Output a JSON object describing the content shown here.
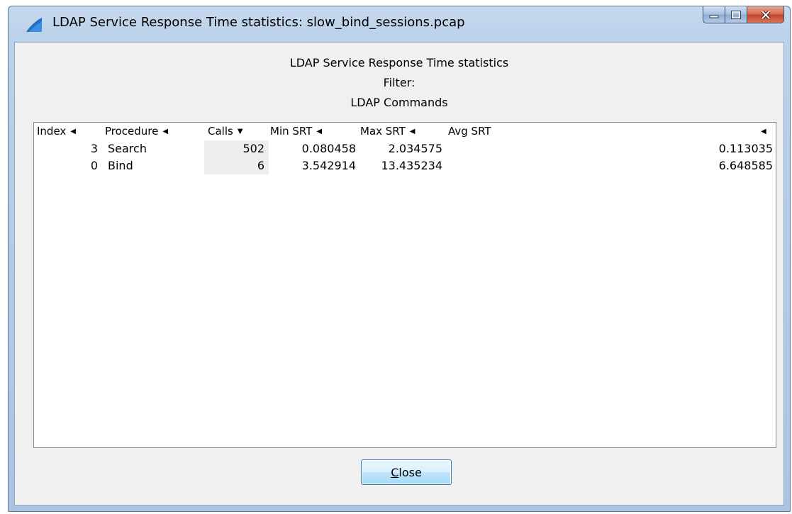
{
  "window": {
    "title": "LDAP Service Response Time statistics: slow_bind_sessions.pcap",
    "caption_buttons": [
      "minimize",
      "maximize",
      "close"
    ]
  },
  "header": {
    "title": "LDAP Service Response Time statistics",
    "filter_label": "Filter:",
    "section_label": "LDAP Commands"
  },
  "table": {
    "columns": [
      "Index",
      "Procedure",
      "Calls",
      "Min SRT",
      "Max SRT",
      "Avg SRT"
    ],
    "sort_column": "Calls",
    "sort_direction": "descending",
    "rows": [
      {
        "index": "3",
        "procedure": "Search",
        "calls": "502",
        "min_srt": "0.080458",
        "max_srt": "2.034575",
        "avg_srt": "0.113035"
      },
      {
        "index": "0",
        "procedure": "Bind",
        "calls": "6",
        "min_srt": "3.542914",
        "max_srt": "13.435234",
        "avg_srt": "6.648585"
      }
    ]
  },
  "buttons": {
    "close_accel": "C",
    "close_rest": "lose"
  }
}
